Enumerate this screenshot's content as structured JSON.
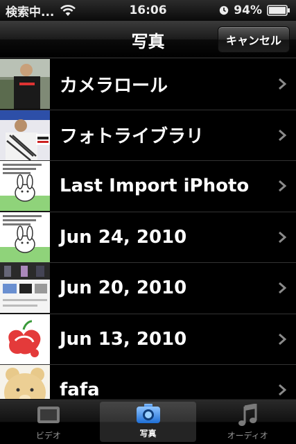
{
  "status": {
    "carrier": "検索中...",
    "time": "16:06",
    "battery": "94%"
  },
  "nav": {
    "title": "写真",
    "cancel_label": "キャンセル"
  },
  "albums": [
    {
      "label": "カメラロール",
      "thumb": "thumb-man-black-shirt"
    },
    {
      "label": "フォトライブラリ",
      "thumb": "thumb-man-costume"
    },
    {
      "label": "Last Import iPhoto",
      "thumb": "thumb-cartoon-rabbit"
    },
    {
      "label": "Jun 24, 2010",
      "thumb": "thumb-cartoon-rabbit"
    },
    {
      "label": "Jun 20, 2010",
      "thumb": "thumb-screenshot"
    },
    {
      "label": "Jun 13, 2010",
      "thumb": "thumb-red-drawing"
    },
    {
      "label": "fafa",
      "thumb": "thumb-plush-bear"
    }
  ],
  "tabs": [
    {
      "label": "ビデオ",
      "icon": "video-icon",
      "selected": false
    },
    {
      "label": "写真",
      "icon": "camera-icon",
      "selected": true
    },
    {
      "label": "オーディオ",
      "icon": "music-note-icon",
      "selected": false
    }
  ],
  "colors": {
    "background": "#000000",
    "tab_selected": "#3a7bd5"
  }
}
